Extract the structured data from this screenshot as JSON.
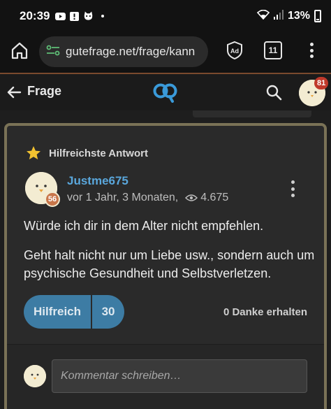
{
  "status_bar": {
    "time": "20:39",
    "battery_percent": "13%",
    "icons_left": [
      "youtube-icon",
      "notification-exclamation-icon",
      "cat-face-icon"
    ],
    "icons_right": [
      "wifi-icon",
      "signal-icon",
      "battery-icon"
    ]
  },
  "browser": {
    "url": "gutefrage.net/frage/kann",
    "tab_count": "11",
    "progress_color": "#7a4a2e"
  },
  "header": {
    "title": "Frage",
    "notification_count": "81",
    "logo_color": "#3a9ad9"
  },
  "answer": {
    "best_label": "Hilfreichste Antwort",
    "author": "Justme675",
    "author_level": "56",
    "time_ago": "vor 1 Jahr, 3 Monaten,",
    "views": "4.675",
    "paragraphs": [
      "Würde dir ich dir in dem Alter nicht empfehlen.",
      "Geht halt nicht nur um Liebe usw., sondern auch um psychische Gesundheit und Selbstverletzen."
    ],
    "helpful_label": "Hilfreich",
    "helpful_count": "30",
    "thanks_text": "0 Danke erhalten"
  },
  "comment": {
    "placeholder": "Kommentar schreiben…"
  },
  "colors": {
    "accent_blue": "#5aa7dc",
    "helpful_button": "#3d7ca4",
    "card_border": "#7a7256",
    "star": "#f2c230",
    "notification_badge": "#c0392b"
  }
}
